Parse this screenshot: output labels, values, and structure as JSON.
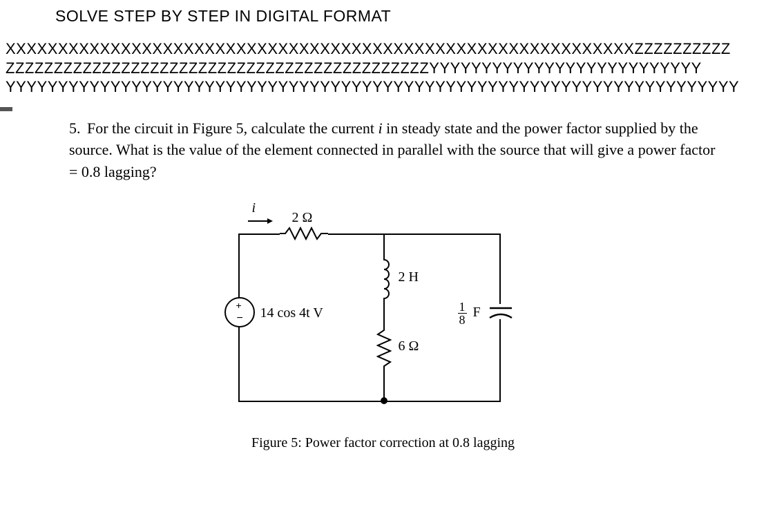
{
  "header": {
    "instruction": "SOLVE STEP BY STEP IN DIGITAL FORMAT"
  },
  "separator": {
    "line1": "XXXXXXXXXXXXXXXXXXXXXXXXXXXXXXXXXXXXXXXXXXXXXXXXXXXXXXXXXXXXZZZZZZZZZZ",
    "line2": "ZZZZZZZZZZZZZZZZZZZZZZZZZZZZZZZZZZZZZZZZZZZZYYYYYYYYYYYYYYYYYYYYYYYYYY",
    "line3": "YYYYYYYYYYYYYYYYYYYYYYYYYYYYYYYYYYYYYYYYYYYYYYYYYYYYYYYYYYYYYYYYYYYYYY"
  },
  "problem": {
    "number": "5.",
    "text_part1": "For the circuit in Figure 5, calculate the current ",
    "var_i": "i",
    "text_part2": " in steady state and the power factor supplied by the source.  What is the value of the element connected in parallel with the source that will give a power factor = 0.8 lagging?"
  },
  "circuit": {
    "current_label": "i",
    "resistor_2ohm": "2 Ω",
    "source_label": "14 cos 4t V",
    "inductor_label": "2 H",
    "resistor_6ohm": "6 Ω",
    "capacitor_frac_num": "1",
    "capacitor_frac_den": "8",
    "capacitor_unit": "F"
  },
  "figure": {
    "caption": "Figure 5: Power factor correction at 0.8 lagging"
  }
}
